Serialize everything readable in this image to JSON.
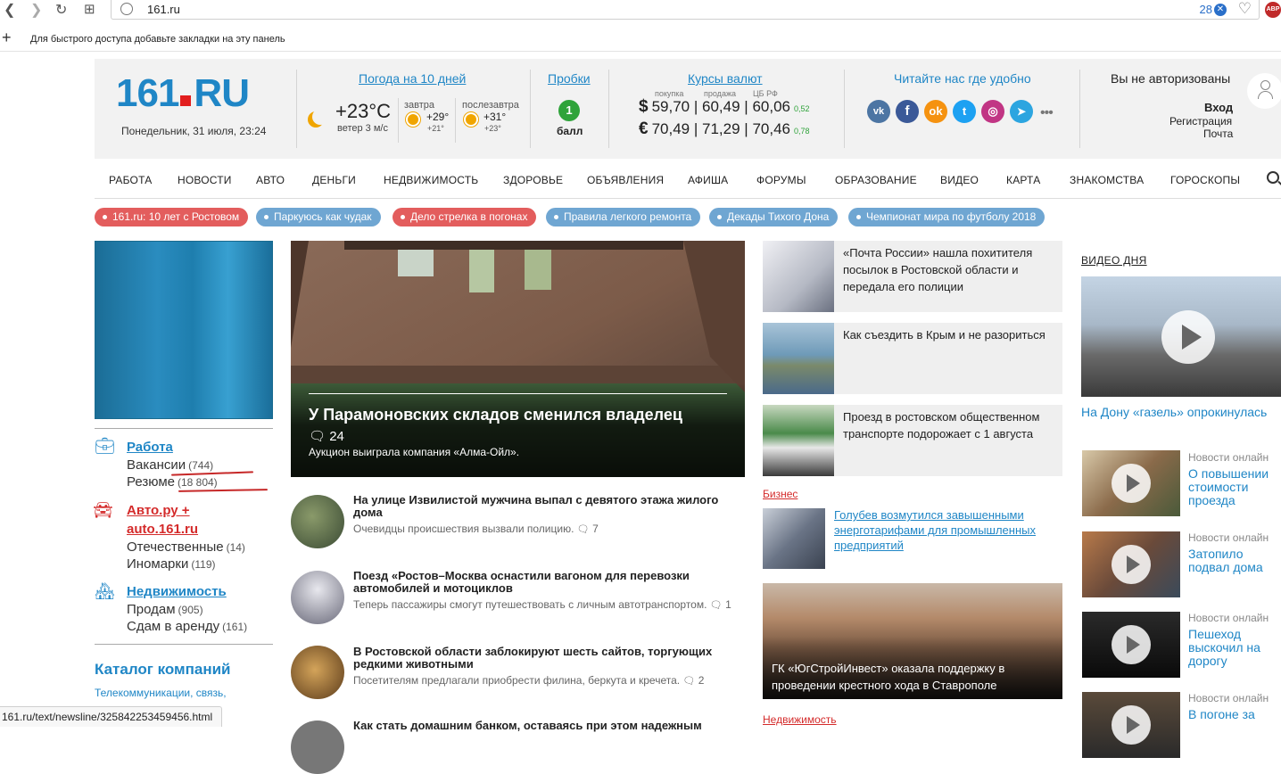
{
  "browser": {
    "url": "161.ru",
    "adblock_count": "28",
    "bookmarks_hint": "Для быстрого доступа добавьте закладки на эту панель",
    "abp_label": "ABP",
    "status_url": "161.ru/text/newsline/325842253459456.html"
  },
  "header": {
    "logo_main": "161",
    "logo_tld": "RU",
    "date": "Понедельник, 31 июля, 23:24",
    "weather": {
      "title": "Погода на 10 дней",
      "now_temp": "+23°C",
      "now_wind": "ветер 3 м/с",
      "tomorrow_label": "завтра",
      "tomorrow_hi": "+29°",
      "tomorrow_lo": "+21°",
      "after_label": "послезавтра",
      "after_hi": "+31°",
      "after_lo": "+23°"
    },
    "traffic": {
      "title": "Пробки",
      "value": "1",
      "unit": "балл"
    },
    "currency": {
      "title": "Курсы валют",
      "col_buy": "покупка",
      "col_sell": "продажа",
      "col_cb": "ЦБ РФ",
      "usd": {
        "symbol": "$",
        "buy": "59,70",
        "sell": "60,49",
        "cb": "60,06",
        "change": "0,52"
      },
      "eur": {
        "symbol": "€",
        "buy": "70,49",
        "sell": "71,29",
        "cb": "70,46",
        "change": "0,78"
      },
      "sep": "|"
    },
    "social": {
      "title": "Читайте нас где удобно",
      "more": "•••"
    },
    "auth": {
      "status": "Вы не авторизованы",
      "login": "Вход",
      "register": "Регистрация",
      "mail": "Почта"
    }
  },
  "nav": [
    "РАБОТА",
    "НОВОСТИ",
    "АВТО",
    "ДЕНЬГИ",
    "НЕДВИЖИМОСТЬ",
    "ЗДОРОВЬЕ",
    "ОБЪЯВЛЕНИЯ",
    "АФИША",
    "ФОРУМЫ",
    "ОБРАЗОВАНИЕ",
    "ВИДЕО",
    "КАРТА",
    "ЗНАКОМСТВА",
    "ГОРОСКОПЫ"
  ],
  "tags": [
    {
      "label": "161.ru: 10 лет с Ростовом",
      "color": "red"
    },
    {
      "label": "Паркуюсь как чудак",
      "color": "blue"
    },
    {
      "label": "Дело стрелка в погонах",
      "color": "red"
    },
    {
      "label": "Правила легкого ремонта",
      "color": "blue"
    },
    {
      "label": "Декады Тихого Дона",
      "color": "blue"
    },
    {
      "label": "Чемпионат мира по футболу 2018",
      "color": "blue"
    }
  ],
  "sidebar": {
    "work": {
      "title": "Работа",
      "vacancies": "Вакансии",
      "vacancies_count": "(744)",
      "resumes": "Резюме",
      "resumes_count": "(18 804)"
    },
    "auto": {
      "title_line1": "Авто.ру +",
      "title_line2": "auto.161.ru",
      "domestic": "Отечественные",
      "domestic_count": "(14)",
      "foreign": "Иномарки",
      "foreign_count": "(119)"
    },
    "realty": {
      "title": "Недвижимость",
      "sell": "Продам",
      "sell_count": "(905)",
      "rent": "Сдам в аренду",
      "rent_count": "(161)"
    },
    "catalog_title": "Каталог компаний",
    "catalog_sub": "Телекоммуникации, связь,"
  },
  "hero": {
    "title": "У Парамоновских складов сменился владелец",
    "comments": "24",
    "subtitle": "Аукцион выиграла компания «Алма-Ойл»."
  },
  "news": [
    {
      "title": "На улице Извилистой мужчина выпал с девятого этажа жилого дома",
      "desc": "Очевидцы происшествия вызвали полицию.",
      "comments": "7"
    },
    {
      "title": "Поезд «Ростов–Москва оснастили вагоном для перевозки автомобилей и мотоциклов",
      "desc": "Теперь пассажиры смогут путешествовать с личным автотранспортом.",
      "comments": "1"
    },
    {
      "title": "В Ростовской области заблокируют шесть сайтов, торгующих редкими животными",
      "desc": "Посетителям предлагали приобрести филина, беркута и кречета.",
      "comments": "2"
    },
    {
      "title": "Как стать домашним банком, оставаясь при этом надежным",
      "desc": "",
      "comments": ""
    }
  ],
  "cards": [
    {
      "text": "«Почта России» нашла похитителя посылок в Ростовской области и передала его полиции"
    },
    {
      "text": "Как съездить в Крым и не разориться"
    },
    {
      "text": "Проезд в ростовском общественном транспорте подорожает с 1 августа"
    }
  ],
  "business": {
    "label": "Бизнес",
    "title": "Голубев возмутился завышенными энерготарифами для промышленных предприятий"
  },
  "big_card": {
    "text": "ГК «ЮгСтройИнвест» оказала поддержку в проведении крестного хода в Ставрополе"
  },
  "realty_label": "Недвижимость",
  "video": {
    "label": "ВИДЕО ДНЯ",
    "main_caption": "На Дону «газель» опрокинулась",
    "items": [
      {
        "label": "Новости онлайн",
        "title": "О повышении стоимости проезда"
      },
      {
        "label": "Новости онлайн",
        "title": "Затопило подвал дома"
      },
      {
        "label": "Новости онлайн",
        "title": "Пешеход выскочил на дорогу"
      },
      {
        "label": "Новости онлайн",
        "title": "В погоне за"
      }
    ]
  },
  "colors": {
    "brand_blue": "#1f86c6",
    "brand_red": "#e21e1e",
    "green": "#2fa33a",
    "tag_red": "#e35d5d",
    "tag_blue": "#6fa6d2"
  }
}
